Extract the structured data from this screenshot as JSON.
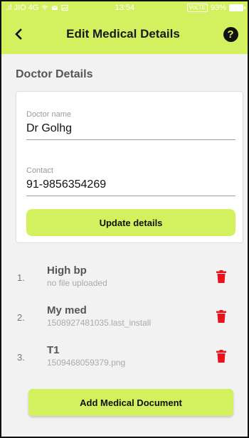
{
  "status_bar": {
    "carrier": ".ıl JIO 4G",
    "time": "13:54",
    "volte": "VoLTE",
    "battery": "93%"
  },
  "header": {
    "title": "Edit Medical Details",
    "back_icon": "chevron-left-icon",
    "help_icon": "question-mark-icon",
    "help_glyph": "?"
  },
  "doctor_section": {
    "title": "Doctor Details",
    "name_label": "Doctor name",
    "name_value": "Dr Golhg",
    "contact_label": "Contact",
    "contact_value": "91-9856354269",
    "update_button": "Update details"
  },
  "documents": [
    {
      "index": "1.",
      "name": "High bp",
      "file": "no file uploaded"
    },
    {
      "index": "2.",
      "name": "My med",
      "file": "1508927481035.last_install"
    },
    {
      "index": "3.",
      "name": "T1",
      "file": "1509468059379.png"
    }
  ],
  "add_document_button": "Add Medical Document",
  "colors": {
    "accent": "#d3f15e",
    "delete": "#e8121c",
    "text_dark": "#111111",
    "text_muted": "#aaaaaa"
  }
}
